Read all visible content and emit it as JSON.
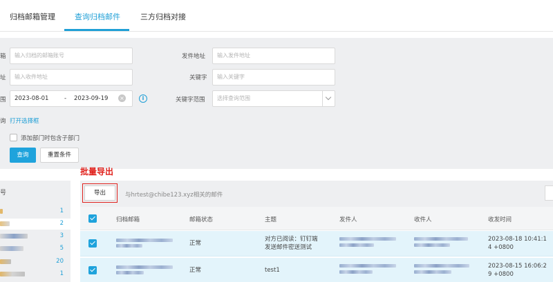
{
  "tabs": [
    {
      "label": "归档邮箱管理",
      "active": false
    },
    {
      "label": "查询归档邮件",
      "active": true
    },
    {
      "label": "三方归档对接",
      "active": false
    }
  ],
  "filters": {
    "mailbox": {
      "label": "箱",
      "placeholder": "输入归档的邮箱账号"
    },
    "sender": {
      "label": "发件地址",
      "placeholder": "输入发件地址"
    },
    "recipient": {
      "label": "址",
      "placeholder": "输入收件地址"
    },
    "keyword": {
      "label": "关键字",
      "placeholder": "输入关键字"
    },
    "date_range": {
      "label": "围",
      "start": "2023-08-01",
      "separator": "-",
      "end": "2023-09-19"
    },
    "keyword_scope": {
      "label": "关键字范围",
      "placeholder": "选择查询范围"
    },
    "dept": {
      "label": "询",
      "link": "打开选择框"
    },
    "include_sub": {
      "label": "添加部门时包含子部门",
      "checked": false
    },
    "query_button": "查询",
    "reset_button": "重置条件"
  },
  "annotation": "批量导出",
  "left_panel": {
    "header": "号",
    "counts": [
      "1",
      "2",
      "3",
      "5",
      "20",
      "1"
    ],
    "selected_index": 1
  },
  "toolbar": {
    "export_label": "导出",
    "related_text": "与hrtest@chibe123.xyz相关的邮件"
  },
  "table": {
    "columns": [
      "归档邮箱",
      "邮箱状态",
      "主题",
      "发件人",
      "收件人",
      "收发时间"
    ],
    "rows": [
      {
        "status": "正常",
        "subject_line1": "对方已阅读：钉钉端",
        "subject_line2": "发送邮件密送测试",
        "time_line1": "2023-08-18 10:41:1",
        "time_line2": "4 +0800",
        "checked": true
      },
      {
        "status": "正常",
        "subject_line1": "test1",
        "subject_line2": "",
        "time_line1": "2023-08-15 16:06:2",
        "time_line2": "9 +0800",
        "checked": true
      }
    ]
  },
  "colors": {
    "accent": "#1f9fd6",
    "annotation_red": "#e0211c",
    "row_selected": "#e3f4fb",
    "filter_bg": "#eeeff1"
  }
}
